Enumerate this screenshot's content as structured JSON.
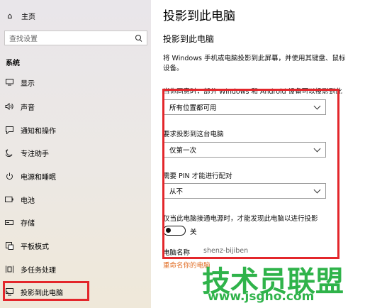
{
  "sidebar": {
    "home_label": "主页",
    "search_placeholder": "查找设置",
    "section_title": "系统",
    "items": [
      {
        "icon": "monitor-icon",
        "label": "显示"
      },
      {
        "icon": "speaker-icon",
        "label": "声音"
      },
      {
        "icon": "notification-icon",
        "label": "通知和操作"
      },
      {
        "icon": "moon-icon",
        "label": "专注助手"
      },
      {
        "icon": "power-icon",
        "label": "电源和睡眠"
      },
      {
        "icon": "battery-icon",
        "label": "电池"
      },
      {
        "icon": "storage-icon",
        "label": "存储"
      },
      {
        "icon": "tablet-icon",
        "label": "平板模式"
      },
      {
        "icon": "multitask-icon",
        "label": "多任务处理"
      },
      {
        "icon": "project-icon",
        "label": "投影到此电脑"
      }
    ]
  },
  "main": {
    "page_title": "投影到此电脑",
    "sub_title": "投影到此电脑",
    "description_line1": "将 Windows 手机或电脑投影到此屏幕，并使用其键盘、鼠标",
    "description_line2": "设备。",
    "clipped_label": "当你同意时，部分 Windows 和 Android 设备可以投影到此",
    "dropdown1_value": "所有位置都可用",
    "label2": "要求投影到这台电脑",
    "dropdown2_value": "仅第一次",
    "label3": "需要 PIN 才能进行配对",
    "dropdown3_value": "从不",
    "label4": "仅当此电脑接通电源时，才能发现此电脑以进行投影",
    "toggle_state": "关",
    "pc_name_label": "电脑名称",
    "pc_name_value": "shenz-bijiben",
    "rename_link": "重命名你的电脑"
  },
  "watermark": {
    "brand": "技术员联盟",
    "url": "www.jsgho.com"
  },
  "colors": {
    "highlight_red": "#e3262b",
    "link_orange": "#e06a1f",
    "watermark_green": "#2fb34a"
  }
}
